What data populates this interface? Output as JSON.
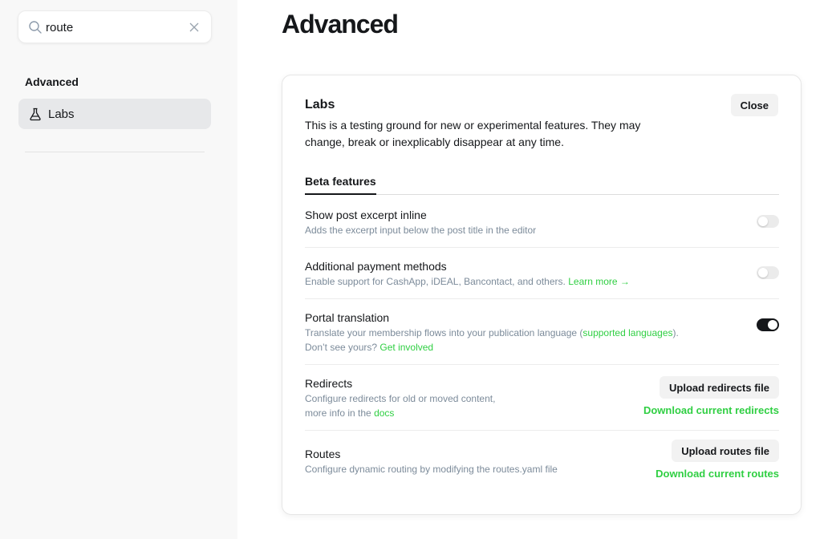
{
  "sidebar": {
    "search": {
      "value": "route",
      "placeholder": "Search settings"
    },
    "section_heading": "Advanced",
    "items": [
      {
        "label": "Labs",
        "icon": "flask-icon"
      }
    ]
  },
  "main": {
    "title": "Advanced",
    "labs": {
      "title": "Labs",
      "description": "This is a testing ground for new or experimental features. They may change, break or inexplicably disappear at any time.",
      "close_label": "Close",
      "tabs": [
        {
          "label": "Beta features",
          "active": true
        }
      ],
      "features": [
        {
          "title": "Show post excerpt inline",
          "desc": "Adds the excerpt input below the post title in the editor",
          "enabled": false
        },
        {
          "title": "Additional payment methods",
          "desc": "Enable support for CashApp, iDEAL, Bancontact, and others.",
          "link": "Learn more →",
          "enabled": false
        },
        {
          "title": "Portal translation",
          "desc_pre": "Translate your membership flows into your publication language (",
          "link1": "supported languages",
          "desc_mid": ").",
          "desc2_pre": "Don’t see yours?",
          "link2": "Get involved",
          "enabled": true
        }
      ],
      "redirects": {
        "title": "Redirects",
        "desc_line1": "Configure redirects for old or moved content,",
        "desc_line2_pre": "more info in the",
        "desc_link": "docs",
        "upload_label": "Upload redirects file",
        "download_label": "Download current redirects"
      },
      "routes": {
        "title": "Routes",
        "desc": "Configure dynamic routing by modifying the routes.yaml file",
        "upload_label": "Upload routes file",
        "download_label": "Download current routes"
      }
    }
  },
  "colors": {
    "accent_green": "#30cf43",
    "toggle_on": "#15171a",
    "toggle_off": "#ebebeb",
    "sidebar_bg": "#f8f8f8"
  }
}
